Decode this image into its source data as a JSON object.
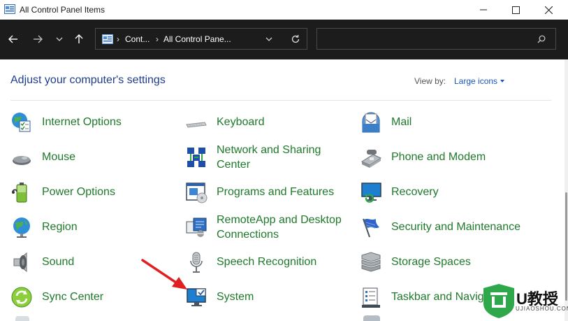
{
  "window": {
    "title": "All Control Panel Items"
  },
  "addressbar": {
    "crumbs": [
      "Cont...",
      "All Control Pane..."
    ]
  },
  "search": {
    "placeholder": ""
  },
  "header": {
    "heading": "Adjust your computer's settings",
    "viewby_label": "View by:",
    "viewby_value": "Large icons"
  },
  "items": [
    {
      "label": "Internet Options",
      "icon": "internet-options-icon"
    },
    {
      "label": "Keyboard",
      "icon": "keyboard-icon"
    },
    {
      "label": "Mail",
      "icon": "mail-icon"
    },
    {
      "label": "Mouse",
      "icon": "mouse-icon"
    },
    {
      "label": "Network and Sharing\nCenter",
      "icon": "network-icon"
    },
    {
      "label": "Phone and Modem",
      "icon": "phone-modem-icon"
    },
    {
      "label": "Power Options",
      "icon": "power-options-icon"
    },
    {
      "label": "Programs and Features",
      "icon": "programs-features-icon"
    },
    {
      "label": "Recovery",
      "icon": "recovery-icon"
    },
    {
      "label": "Region",
      "icon": "region-icon"
    },
    {
      "label": "RemoteApp and Desktop\nConnections",
      "icon": "remoteapp-icon"
    },
    {
      "label": "Security and Maintenance",
      "icon": "security-flag-icon"
    },
    {
      "label": "Sound",
      "icon": "speaker-icon"
    },
    {
      "label": "Speech Recognition",
      "icon": "microphone-icon"
    },
    {
      "label": "Storage Spaces",
      "icon": "storage-spaces-icon"
    },
    {
      "label": "Sync Center",
      "icon": "sync-center-icon"
    },
    {
      "label": "System",
      "icon": "system-monitor-icon"
    },
    {
      "label": "Taskbar and Navigation",
      "icon": "taskbar-icon"
    }
  ],
  "watermark": {
    "text": "U教授",
    "sub": "UJIAOSHOU.COM"
  },
  "colors": {
    "link_green": "#1e7a2a",
    "heading_blue": "#1e3e8c",
    "toolbar_bg": "#1c1c1c",
    "arrow_red": "#e02020"
  }
}
